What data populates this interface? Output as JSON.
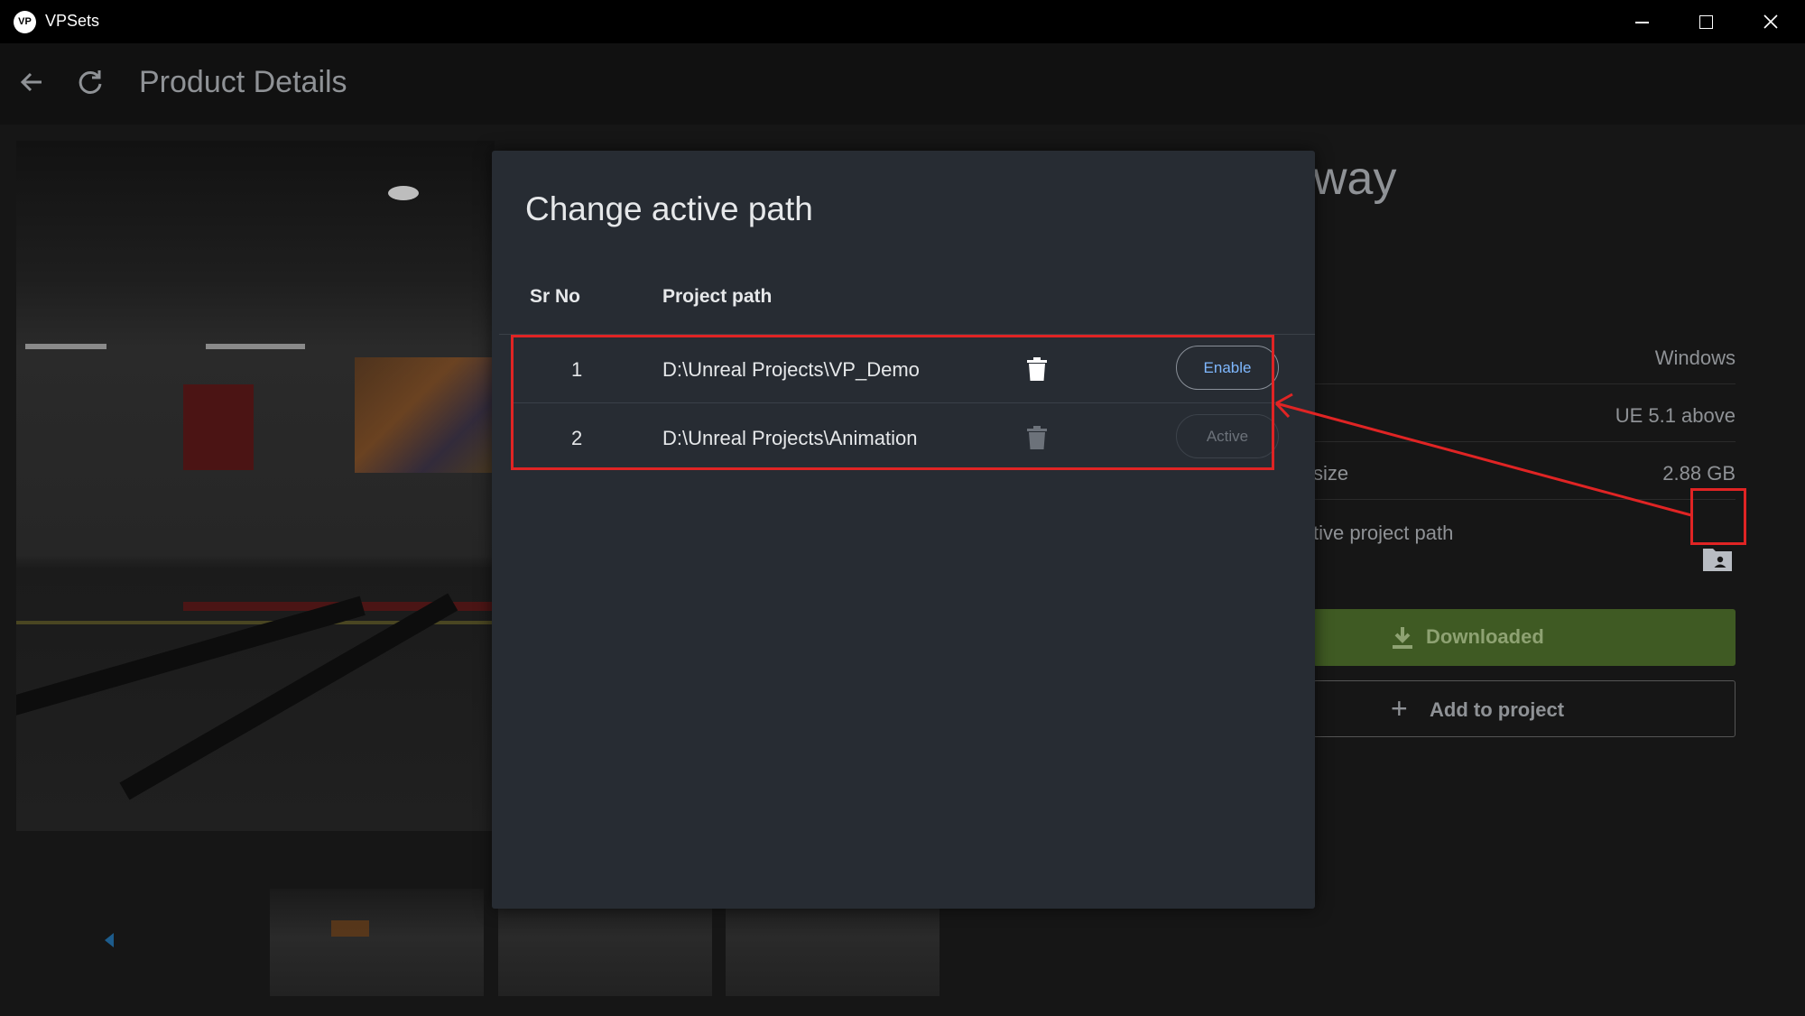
{
  "window": {
    "logo_text": "VP",
    "app_name": "VPSets",
    "controls": [
      "minimize-icon",
      "maximize-icon",
      "close-icon"
    ]
  },
  "appbar": {
    "back_icon": "arrow-left-icon",
    "refresh_icon": "refresh-icon",
    "title": "Product Details"
  },
  "product": {
    "heading_fragment": "way",
    "details": [
      {
        "label": "",
        "value": "Windows"
      },
      {
        "label": "",
        "value": "UE 5.1 above"
      },
      {
        "label": "size",
        "value": "2.88 GB"
      },
      {
        "label": "tive project path",
        "value": ""
      }
    ],
    "folder_icon": "folder-user-icon",
    "downloaded_label": "Downloaded",
    "add_to_project_label": "Add to project"
  },
  "dialog": {
    "title": "Change active path",
    "columns": {
      "sr_no": "Sr No",
      "project_path": "Project path"
    },
    "rows": [
      {
        "sr": "1",
        "path": "D:\\Unreal Projects\\VP_Demo",
        "button": "Enable",
        "state": "enabled"
      },
      {
        "sr": "2",
        "path": "D:\\Unreal Projects\\Animation",
        "button": "Active",
        "state": "disabled"
      }
    ]
  },
  "colors": {
    "annotation": "#e02424",
    "dialog_bg": "#272c33",
    "enable_text": "#7fb8ff",
    "downloaded_bg": "#3f5a23"
  }
}
